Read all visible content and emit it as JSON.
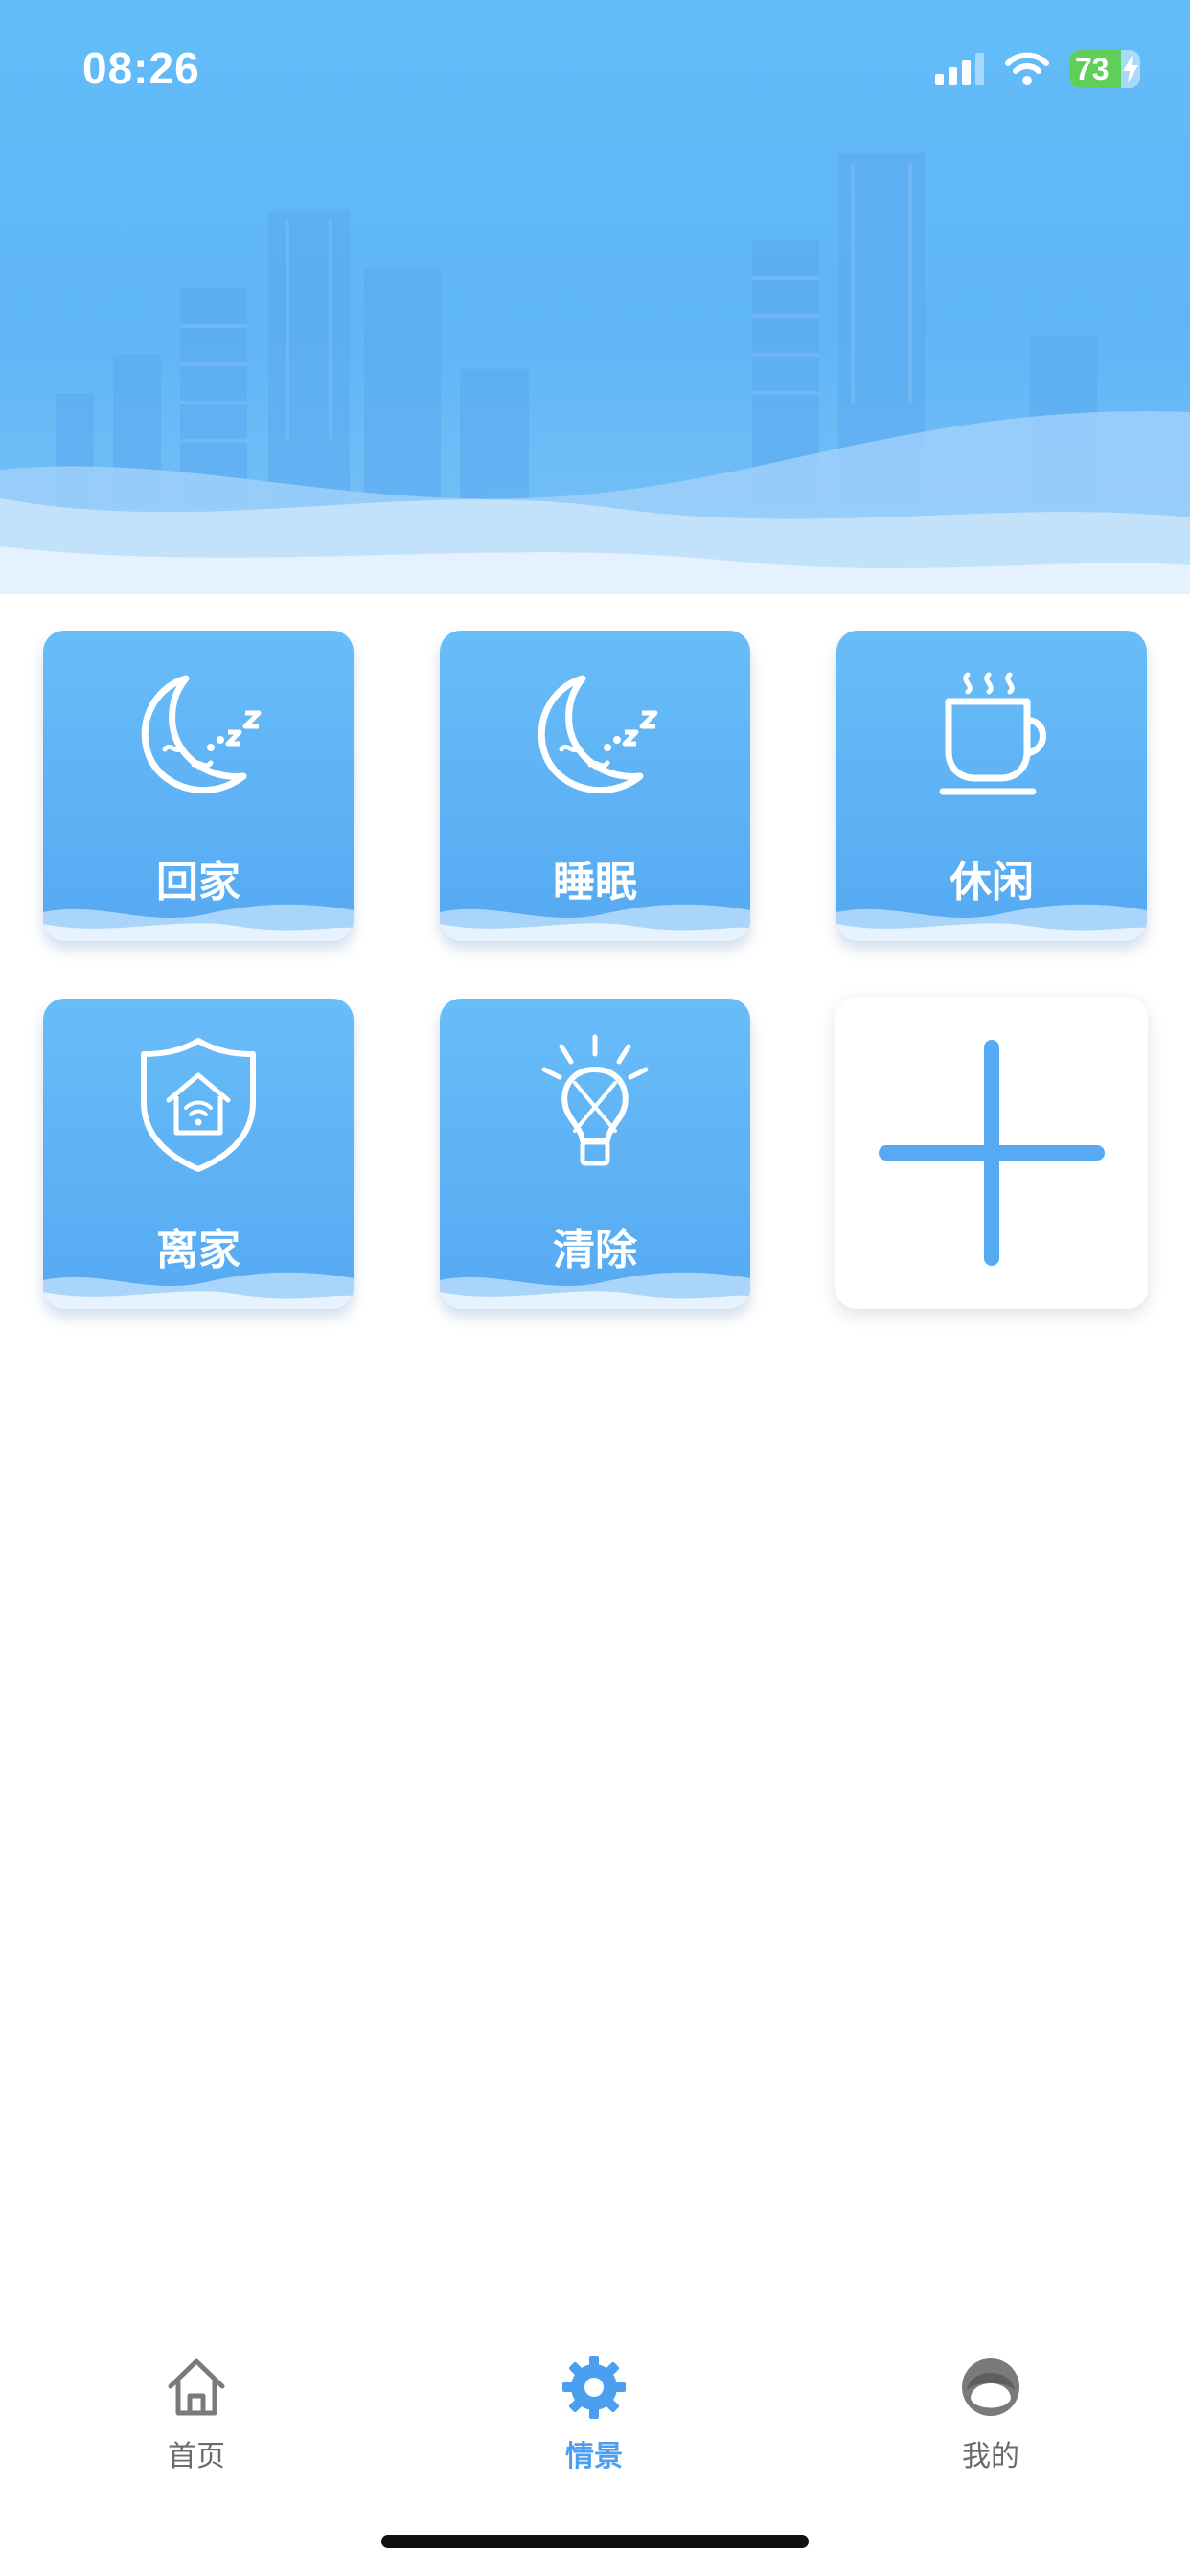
{
  "status_bar": {
    "time": "08:26",
    "battery_level": "73",
    "battery_fraction": 0.73
  },
  "scenes": [
    {
      "label": "回家",
      "icon": "moon-sleep-icon"
    },
    {
      "label": "睡眠",
      "icon": "moon-sleep-icon"
    },
    {
      "label": "休闲",
      "icon": "coffee-cup-icon"
    },
    {
      "label": "离家",
      "icon": "shield-home-icon"
    },
    {
      "label": "清除",
      "icon": "bulb-off-icon"
    }
  ],
  "add_scene": {
    "icon": "plus-icon"
  },
  "bottom_nav": {
    "items": [
      {
        "label": "首页",
        "icon": "home-icon",
        "active": false
      },
      {
        "label": "情景",
        "icon": "gear-icon",
        "active": true
      },
      {
        "label": "我的",
        "icon": "avatar-icon",
        "active": false
      }
    ]
  },
  "colors": {
    "primary": "#56a9f2",
    "active_nav": "#4c9ff0",
    "inactive_nav": "#6b6b6b",
    "banner": "#63bdf8"
  }
}
